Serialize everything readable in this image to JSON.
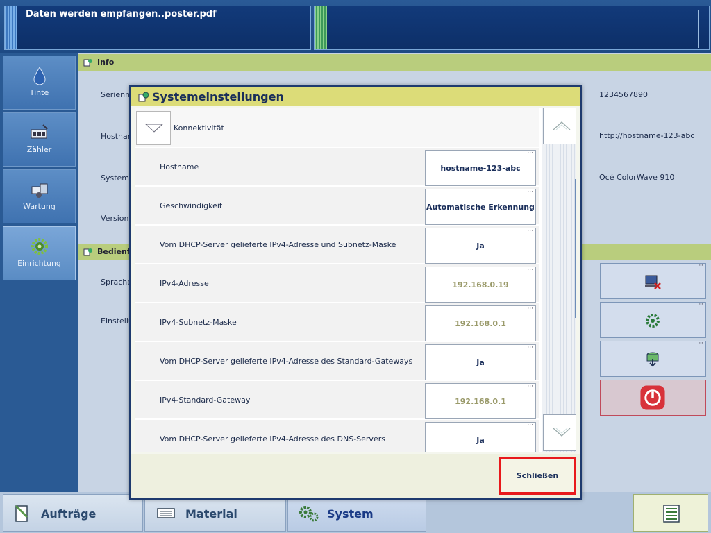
{
  "status": {
    "message": "Daten werden empfangen...",
    "file": "poster.pdf"
  },
  "nav": {
    "items": [
      {
        "label": "Tinte",
        "icon": "ink-drop-icon"
      },
      {
        "label": "Zähler",
        "icon": "counter-icon"
      },
      {
        "label": "Wartung",
        "icon": "maintenance-icon"
      },
      {
        "label": "Einrichtung",
        "icon": "gear-icon"
      }
    ]
  },
  "background": {
    "info_header": "Info",
    "labels": [
      "Seriennu",
      "Hostnam",
      "System",
      "Version d"
    ],
    "values": [
      "1234567890",
      "http://hostname-123-abc",
      "Océ ColorWave 910"
    ],
    "bedien_header": "Bedienfe",
    "bedien_labels": [
      "Sprache",
      "Einstellu"
    ]
  },
  "dialog": {
    "title": "Systemeinstellungen",
    "category": "Konnektivität",
    "more_indicator": "···",
    "rows": [
      {
        "label": "Hostname",
        "value": "hostname-123-abc",
        "readonly": false
      },
      {
        "label": "Geschwindigkeit",
        "value": "Automatische Erkennung",
        "readonly": false
      },
      {
        "label": "Vom DHCP-Server gelieferte IPv4-Adresse und Subnetz-Maske",
        "value": "Ja",
        "readonly": false
      },
      {
        "label": "IPv4-Adresse",
        "value": "192.168.0.19",
        "readonly": true
      },
      {
        "label": "IPv4-Subnetz-Maske",
        "value": "192.168.0.1",
        "readonly": true
      },
      {
        "label": "Vom DHCP-Server gelieferte IPv4-Adresse des Standard-Gateways",
        "value": "Ja",
        "readonly": false
      },
      {
        "label": "IPv4-Standard-Gateway",
        "value": "192.168.0.1",
        "readonly": true
      },
      {
        "label": "Vom DHCP-Server gelieferte IPv4-Adresse des DNS-Servers",
        "value": "Ja",
        "readonly": false
      }
    ],
    "close_label": "Schließen"
  },
  "tabs": [
    {
      "label": "Aufträge",
      "icon": "jobs-icon"
    },
    {
      "label": "Material",
      "icon": "material-icon"
    },
    {
      "label": "System",
      "icon": "system-gears-icon",
      "active": true
    }
  ],
  "colors": {
    "title_bar": "#dcdc78",
    "close_highlight": "#e8191c",
    "readonly_text": "#9a9a6a"
  }
}
